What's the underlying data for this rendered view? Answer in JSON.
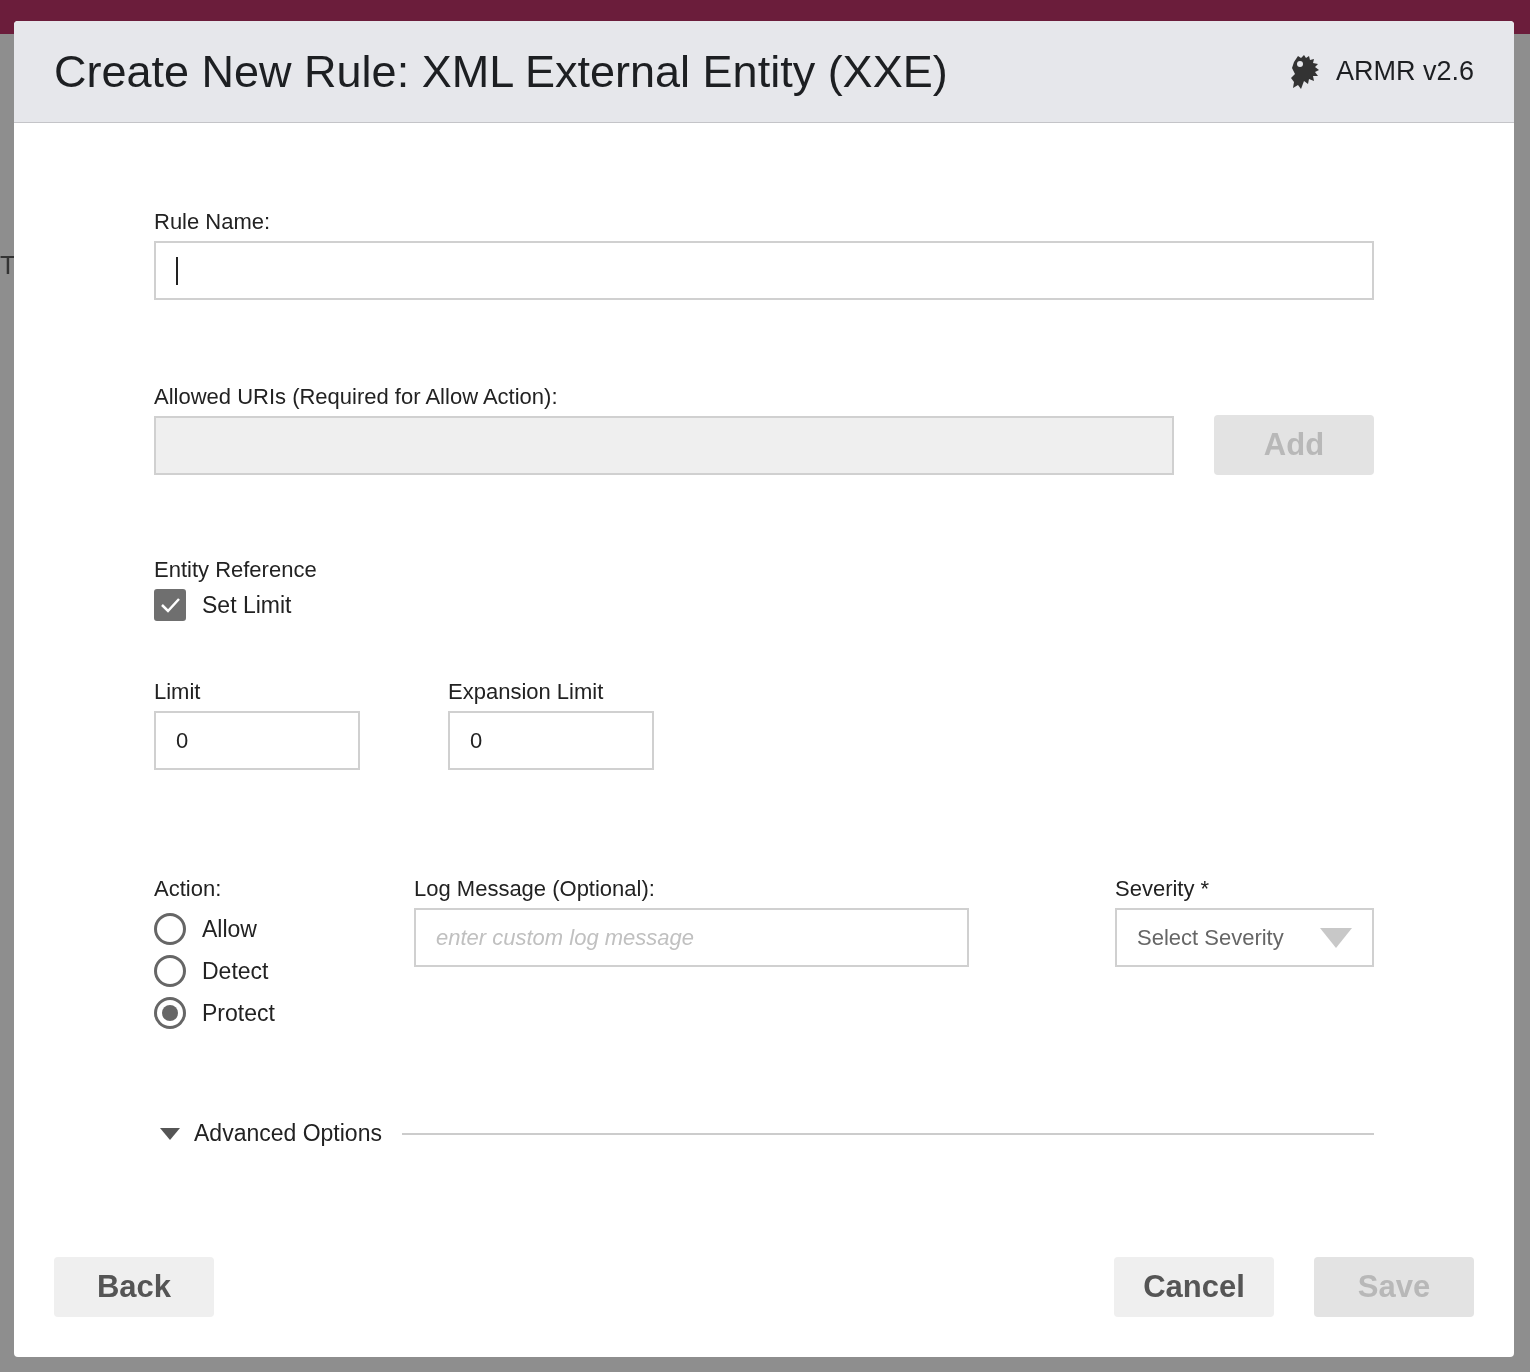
{
  "background": {
    "fragment": "T"
  },
  "dialog": {
    "title": "Create New Rule: XML External Entity (XXE)",
    "version": "ARMR v2.6"
  },
  "rule_name": {
    "label": "Rule Name:",
    "focused": true
  },
  "allowed_uris": {
    "label": "Allowed URIs (Required for Allow Action):",
    "disabled": true,
    "button": {
      "label": "Add",
      "disabled": true
    }
  },
  "entity_reference": {
    "heading": "Entity Reference",
    "set_limit": {
      "label": "Set Limit",
      "checked": true
    }
  },
  "limits": [
    {
      "label": "Limit",
      "value": "0"
    },
    {
      "label": "Expansion Limit",
      "value": "0"
    }
  ],
  "action": {
    "label": "Action:",
    "options": [
      {
        "label": "Allow",
        "selected": false
      },
      {
        "label": "Detect",
        "selected": false
      },
      {
        "label": "Protect",
        "selected": true
      }
    ]
  },
  "log_message": {
    "label": "Log Message (Optional):",
    "placeholder": "enter custom log message"
  },
  "severity": {
    "label": "Severity *",
    "placeholder": "Select Severity"
  },
  "advanced_options": {
    "label": "Advanced Options"
  },
  "footer": {
    "left_buttons": [
      {
        "label": "Back",
        "disabled": false
      }
    ],
    "right_buttons": [
      {
        "label": "Cancel",
        "disabled": false
      },
      {
        "label": "Save",
        "disabled": true
      }
    ]
  }
}
